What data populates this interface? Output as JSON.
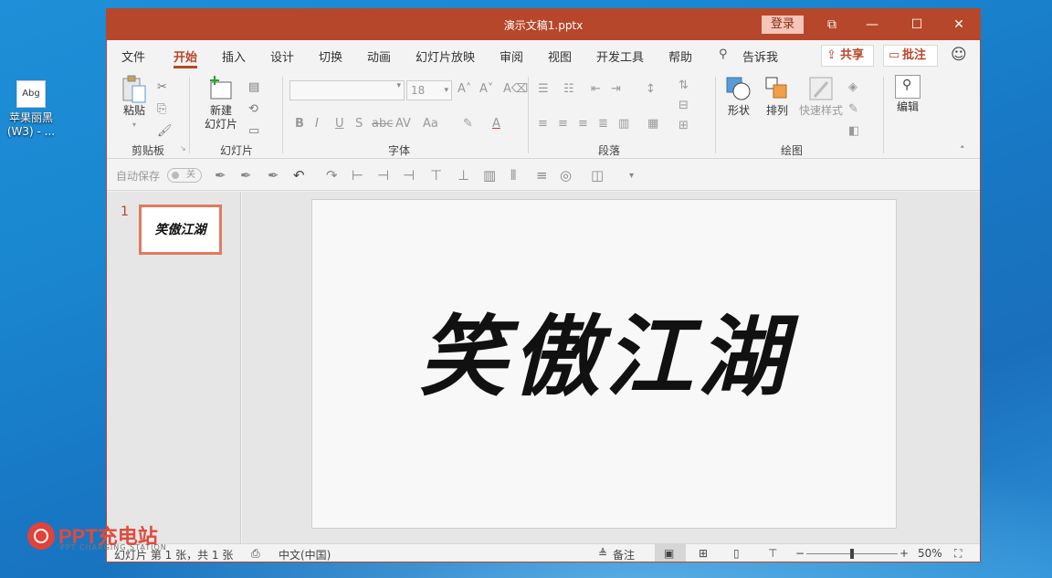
{
  "desktop": {
    "icon_text": "Abg",
    "icon_label_line1": "苹果丽黑",
    "icon_label_line2": "(W3) - ..."
  },
  "window": {
    "title": "演示文稿1.pptx",
    "login_label": "登录",
    "controls": {
      "ribbon_display": "⧉",
      "minimize": "—",
      "maximize": "☐",
      "close": "✕"
    }
  },
  "tabs": [
    "文件",
    "开始",
    "插入",
    "设计",
    "切换",
    "动画",
    "幻灯片放映",
    "审阅",
    "视图",
    "开发工具",
    "帮助"
  ],
  "active_tab": "开始",
  "tell_me": "告诉我",
  "share_label": "共享",
  "comment_label": "批注",
  "ribbon": {
    "clipboard": {
      "paste_label": "粘贴",
      "group_label": "剪贴板"
    },
    "slides": {
      "new_slide_line1": "新建",
      "new_slide_line2": "幻灯片",
      "group_label": "幻灯片"
    },
    "font": {
      "font_name": "",
      "font_size": "18",
      "group_label": "字体"
    },
    "paragraph": {
      "group_label": "段落"
    },
    "drawing": {
      "shape_label": "形状",
      "arrange_label": "排列",
      "quick_style_label": "快速样式",
      "group_label": "绘图"
    },
    "editing": {
      "edit_label": "编辑"
    }
  },
  "qat": {
    "autosave_label": "自动保存",
    "toggle_label": "关"
  },
  "slides_pane": {
    "thumb_number": "1",
    "thumb_text": "笑傲江湖"
  },
  "slide": {
    "calligraphy_text": "笑傲江湖"
  },
  "status": {
    "slide_info": "幻灯片 第 1 张，共 1 张",
    "language": "中文(中国)",
    "notes_label": "备注",
    "zoom": "50%",
    "zoom_fraction": 0.5
  },
  "watermark": {
    "title": "PPT充电站",
    "subtitle": "PPT CHARGING STATION"
  }
}
